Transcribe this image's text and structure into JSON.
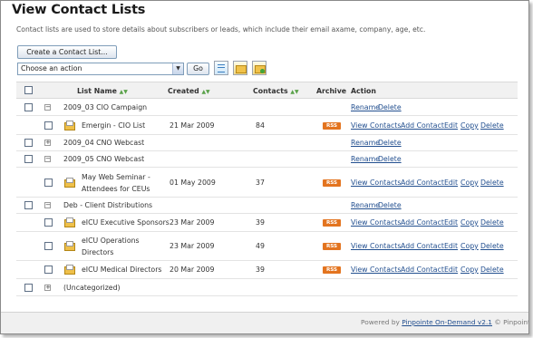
{
  "page": {
    "title": "View Contact Lists",
    "description": "Contact lists are used to store details about subscribers or leads, which include their email axame, company, age, etc."
  },
  "toolbar": {
    "create_label": "Create a Contact List...",
    "action_value": "Choose an action",
    "go_label": "Go"
  },
  "table": {
    "headers": {
      "name": "List Name",
      "created": "Created",
      "contacts": "Contacts",
      "archive": "Archive",
      "action": "Action"
    },
    "rss_label": "RSS",
    "rows": [
      {
        "type": "folder",
        "toggle": "−",
        "name": "2009_03 CIO Campaign",
        "actions": [
          "Rename",
          "Delete"
        ]
      },
      {
        "type": "list",
        "name": "Emergin - CIO List",
        "created": "21 Mar 2009",
        "contacts": "84",
        "actions": [
          "View Contacts",
          "Add Contact",
          "Edit",
          "Copy",
          "Delete"
        ]
      },
      {
        "type": "folder",
        "toggle": "+",
        "name": "2009_04 CNO Webcast",
        "actions": [
          "Rename",
          "Delete"
        ]
      },
      {
        "type": "folder",
        "toggle": "−",
        "name": "2009_05 CNO Webcast",
        "actions": [
          "Rename",
          "Delete"
        ]
      },
      {
        "type": "list",
        "name1": "May Web Seminar -",
        "name2": "Attendees for CEUs",
        "created": "01 May 2009",
        "contacts": "37",
        "actions": [
          "View Contacts",
          "Add Contact",
          "Edit",
          "Copy",
          "Delete"
        ]
      },
      {
        "type": "folder",
        "toggle": "−",
        "name": "Deb - Client Distributions",
        "actions": [
          "Rename",
          "Delete"
        ]
      },
      {
        "type": "list",
        "name": "eICU Executive Sponsors",
        "created": "23 Mar 2009",
        "contacts": "39",
        "actions": [
          "View Contacts",
          "Add Contact",
          "Edit",
          "Copy",
          "Delete"
        ]
      },
      {
        "type": "list",
        "name1": "eICU Operations",
        "name2": "Directors",
        "created": "23 Mar 2009",
        "contacts": "49",
        "actions": [
          "View Contacts",
          "Add Contact",
          "Edit",
          "Copy",
          "Delete"
        ]
      },
      {
        "type": "list",
        "name": "eICU Medical Directors",
        "created": "20 Mar 2009",
        "contacts": "39",
        "actions": [
          "View Contacts",
          "Add Contact",
          "Edit",
          "Copy",
          "Delete"
        ]
      },
      {
        "type": "folder",
        "toggle": "+",
        "name": "(Uncategorized)",
        "actions": []
      }
    ]
  },
  "footer": {
    "prefix": "Powered by",
    "link": "Pinpointe On-Demand v2.1",
    "suffix": "© Pinpoint"
  },
  "colors": {
    "link": "#224f8f",
    "rss": "#e3741f",
    "header_bg": "#f1f1f1",
    "footer_bg": "#f0f0f0"
  }
}
